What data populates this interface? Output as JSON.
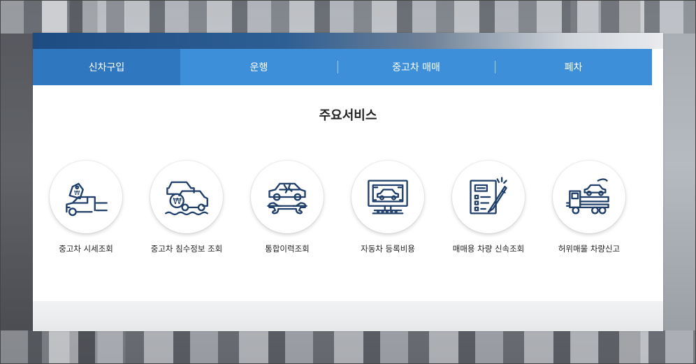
{
  "nav": {
    "tabs": [
      {
        "label": "신차구입",
        "active": true
      },
      {
        "label": "운행",
        "active": false
      },
      {
        "label": "중고차 매매",
        "active": false
      },
      {
        "label": "폐차",
        "active": false
      }
    ]
  },
  "main": {
    "title": "주요서비스",
    "services": [
      {
        "label": "중고차 시세조회",
        "icon": "price-tag-car-icon"
      },
      {
        "label": "중고차 침수정보 조회",
        "icon": "flood-car-won-icon"
      },
      {
        "label": "통합이력조회",
        "icon": "car-repair-wrench-icon"
      },
      {
        "label": "자동차 등록비용",
        "icon": "monitor-car-icon"
      },
      {
        "label": "매매용 차량 신속조회",
        "icon": "checklist-pen-icon"
      },
      {
        "label": "허위매물 차량신고",
        "icon": "tow-truck-icon"
      }
    ]
  },
  "colors": {
    "nav_bg": "#3c8fd8",
    "nav_active": "#2f78bf",
    "icon_stroke": "#1f3f6a"
  }
}
